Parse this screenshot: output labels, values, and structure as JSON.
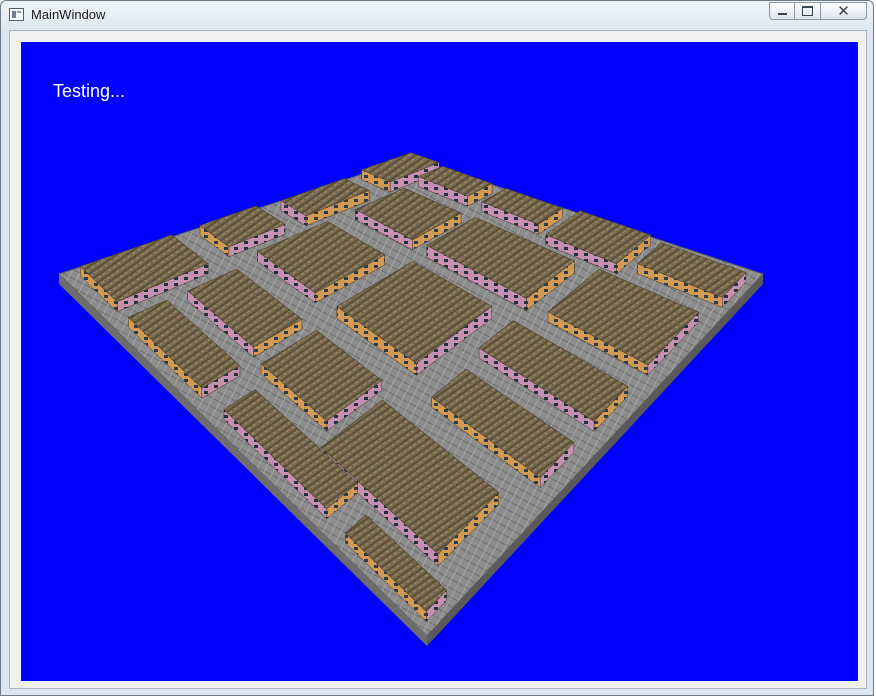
{
  "window": {
    "title": "MainWindow"
  },
  "caption_buttons": {
    "minimize_icon": "minimize-icon",
    "maximize_icon": "maximize-icon",
    "close_icon": "close-icon",
    "close_glyph": "✕"
  },
  "viewport": {
    "overlay_text": "Testing...",
    "background_color": "#0000ff",
    "scene": {
      "ground_color": "#8c8c8c",
      "roof_color": "#7d6d4e",
      "wall_colors": [
        "#d79a4f",
        "#c98fa8",
        "#b69a7a"
      ]
    }
  }
}
